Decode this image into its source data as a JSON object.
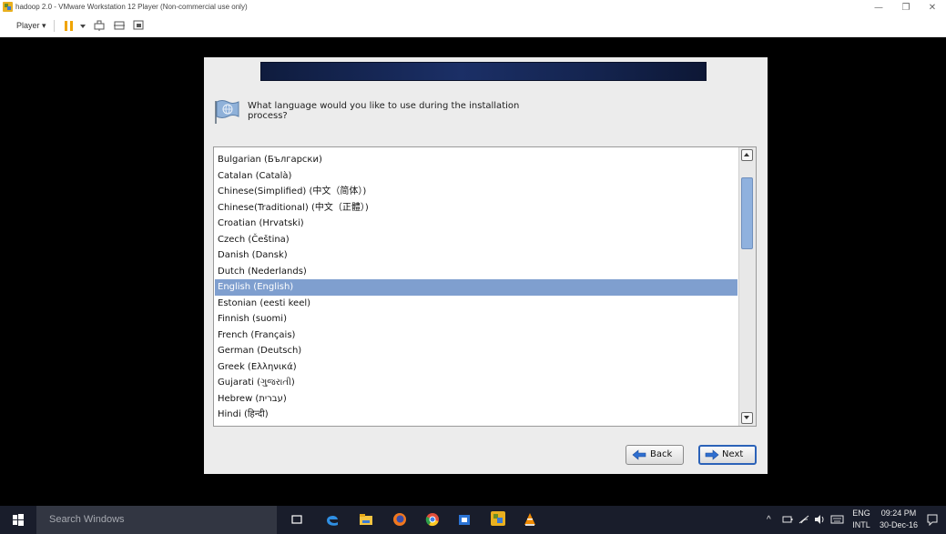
{
  "window": {
    "title": "hadoop 2.0 - VMware Workstation 12 Player (Non-commercial use only)",
    "controls": {
      "minimize": "—",
      "maximize": "❐",
      "close": "✕"
    }
  },
  "toolbar": {
    "player_label": "Player ▾"
  },
  "installer": {
    "question": "What language would you like to use during the installation process?",
    "languages": [
      "Bulgarian (Български)",
      "Catalan (Català)",
      "Chinese(Simplified) (中文（简体）)",
      "Chinese(Traditional) (中文（正體）)",
      "Croatian (Hrvatski)",
      "Czech (Čeština)",
      "Danish (Dansk)",
      "Dutch (Nederlands)",
      "English (English)",
      "Estonian (eesti keel)",
      "Finnish (suomi)",
      "French (Français)",
      "German (Deutsch)",
      "Greek (Ελληνικά)",
      "Gujarati (ગુજરાતી)",
      "Hebrew (עברית)",
      "Hindi (हिन्दी)"
    ],
    "selected_language": "English (English)",
    "back_label": "Back",
    "next_label": "Next"
  },
  "taskbar": {
    "search_placeholder": "Search Windows",
    "language_line1": "ENG",
    "language_line2": "INTL",
    "time": "09:24 PM",
    "date": "30-Dec-16"
  },
  "colors": {
    "selection": "#7f9fcf",
    "taskbar": "#191d2b",
    "dialog": "#ececec"
  }
}
